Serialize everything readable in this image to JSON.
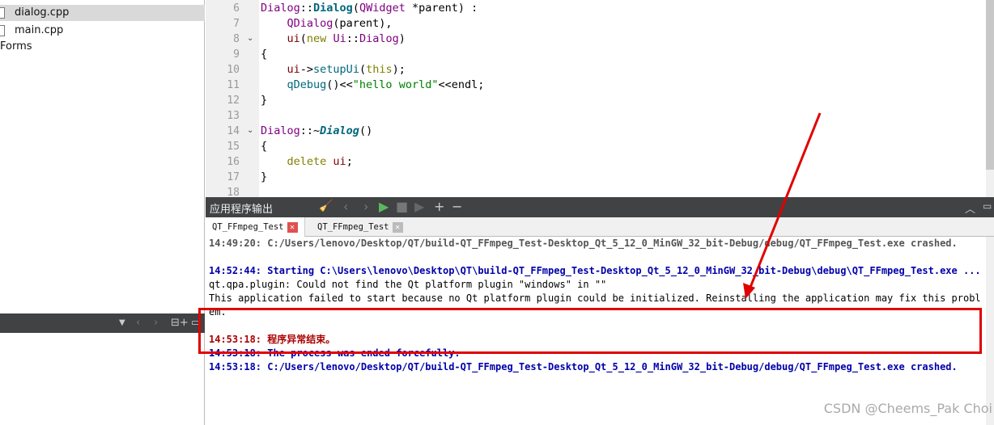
{
  "sidebar": {
    "files": [
      {
        "name": "dialog.cpp",
        "selected": true
      },
      {
        "name": "main.cpp",
        "selected": false
      }
    ],
    "folder": "Forms"
  },
  "editor": {
    "lines": [
      {
        "n": "6",
        "tokens": [
          {
            "t": "Dialog",
            "c": "#800080"
          },
          {
            "t": "::",
            "c": "#000"
          },
          {
            "t": "Dialog",
            "c": "#00677c",
            "b": true
          },
          {
            "t": "(",
            "c": "#000"
          },
          {
            "t": "QWidget",
            "c": "#800080"
          },
          {
            "t": " *parent) :",
            "c": "#000"
          }
        ]
      },
      {
        "n": "7",
        "tokens": [
          {
            "t": "    QDialog",
            "c": "#800080"
          },
          {
            "t": "(parent),",
            "c": "#000"
          }
        ]
      },
      {
        "n": "8",
        "fold": true,
        "tokens": [
          {
            "t": "    ui",
            "c": "#800000"
          },
          {
            "t": "(",
            "c": "#000"
          },
          {
            "t": "new",
            "c": "#808000"
          },
          {
            "t": " ",
            "c": "#000"
          },
          {
            "t": "Ui",
            "c": "#800080"
          },
          {
            "t": "::",
            "c": "#000"
          },
          {
            "t": "Dialog",
            "c": "#800080"
          },
          {
            "t": ")",
            "c": "#000"
          }
        ]
      },
      {
        "n": "9",
        "tokens": [
          {
            "t": "{",
            "c": "#000"
          }
        ]
      },
      {
        "n": "10",
        "tokens": [
          {
            "t": "    ui",
            "c": "#800000"
          },
          {
            "t": "->",
            "c": "#000"
          },
          {
            "t": "setupUi",
            "c": "#00677c"
          },
          {
            "t": "(",
            "c": "#000"
          },
          {
            "t": "this",
            "c": "#808000"
          },
          {
            "t": ");",
            "c": "#000"
          }
        ]
      },
      {
        "n": "11",
        "tokens": [
          {
            "t": "    qDebug",
            "c": "#00677c"
          },
          {
            "t": "()<<",
            "c": "#000"
          },
          {
            "t": "\"hello world\"",
            "c": "#008000"
          },
          {
            "t": "<<endl;",
            "c": "#000"
          }
        ]
      },
      {
        "n": "12",
        "tokens": [
          {
            "t": "}",
            "c": "#000"
          }
        ]
      },
      {
        "n": "13",
        "tokens": []
      },
      {
        "n": "14",
        "fold": true,
        "tokens": [
          {
            "t": "Dialog",
            "c": "#800080"
          },
          {
            "t": "::~",
            "c": "#000"
          },
          {
            "t": "Dialog",
            "c": "#00677c",
            "b": true,
            "i": true
          },
          {
            "t": "()",
            "c": "#000"
          }
        ]
      },
      {
        "n": "15",
        "tokens": [
          {
            "t": "{",
            "c": "#000"
          }
        ]
      },
      {
        "n": "16",
        "tokens": [
          {
            "t": "    delete",
            "c": "#808000"
          },
          {
            "t": " ",
            "c": "#000"
          },
          {
            "t": "ui",
            "c": "#800000"
          },
          {
            "t": ";",
            "c": "#000"
          }
        ]
      },
      {
        "n": "17",
        "tokens": [
          {
            "t": "}",
            "c": "#000"
          }
        ]
      },
      {
        "n": "18",
        "tokens": []
      }
    ]
  },
  "output": {
    "title": "应用程序输出",
    "tabs": [
      {
        "label": "QT_FFmpeg_Test",
        "active": true
      },
      {
        "label": "QT_FFmpeg_Test",
        "active": false
      }
    ],
    "lines": [
      {
        "t": "14:49:20: C:/Users/lenovo/Desktop/QT/build-QT_FFmpeg_Test-Desktop_Qt_5_12_0_MinGW_32_bit-Debug/debug/QT_FFmpeg_Test.exe crashed.",
        "c": "#555555",
        "b": true
      },
      {
        "t": "",
        "c": "#000"
      },
      {
        "t": "14:52:44: Starting C:\\Users\\lenovo\\Desktop\\QT\\build-QT_FFmpeg_Test-Desktop_Qt_5_12_0_MinGW_32_bit-Debug\\debug\\QT_FFmpeg_Test.exe ...",
        "c": "#0000aa",
        "b": true
      },
      {
        "t": "qt.qpa.plugin: Could not find the Qt platform plugin \"windows\" in \"\"",
        "c": "#000",
        "b": false
      },
      {
        "t": "This application failed to start because no Qt platform plugin could be initialized. Reinstalling the application may fix this problem.",
        "c": "#000",
        "b": false
      },
      {
        "t": "",
        "c": "#000"
      },
      {
        "t": "14:53:18: 程序异常结束。",
        "c": "#aa0000",
        "b": true
      },
      {
        "t": "14:53:18: The process was ended forcefully.",
        "c": "#0000aa",
        "b": true
      },
      {
        "t": "14:53:18: C:/Users/lenovo/Desktop/QT/build-QT_FFmpeg_Test-Desktop_Qt_5_12_0_MinGW_32_bit-Debug/debug/QT_FFmpeg_Test.exe crashed.",
        "c": "#0000aa",
        "b": true
      }
    ]
  },
  "watermark": "CSDN @Cheems_Pak Choi",
  "colors": {
    "annotation": "#e00000",
    "toolbar": "#404244",
    "run": "#5cb85c"
  }
}
